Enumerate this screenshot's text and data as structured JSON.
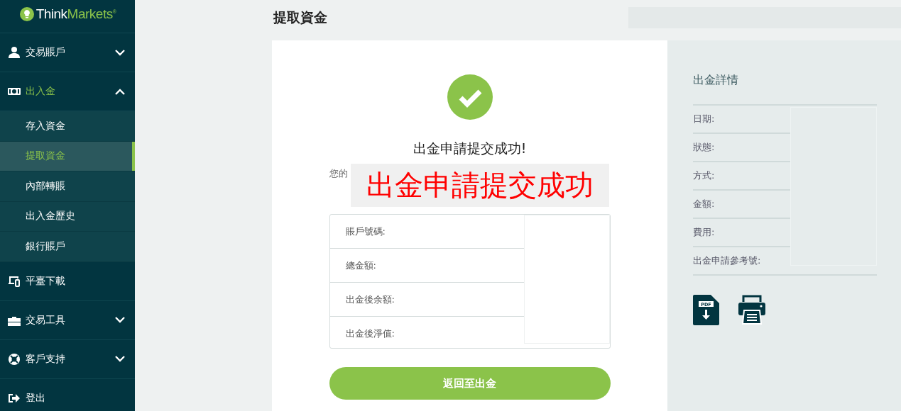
{
  "logo": {
    "think": "Think",
    "markets": "Markets",
    "reg": "®"
  },
  "sidebar": {
    "items": [
      {
        "label": "交易賬戶",
        "expanded": false
      },
      {
        "label": "出入金",
        "expanded": true,
        "children": [
          {
            "label": "存入資金",
            "selected": false
          },
          {
            "label": "提取資金",
            "selected": true
          },
          {
            "label": "內部轉賬",
            "selected": false
          },
          {
            "label": "出入金歷史",
            "selected": false
          },
          {
            "label": "銀行賬戶",
            "selected": false
          }
        ]
      },
      {
        "label": "平臺下載"
      },
      {
        "label": "交易工具",
        "expanded": false
      },
      {
        "label": "客戶支持",
        "expanded": false
      },
      {
        "label": "登出"
      }
    ]
  },
  "page_title": "提取資金",
  "result": {
    "title": "出金申請提交成功!",
    "notice_fragments": [
      "您的"
    ],
    "overlay_label": "出金申請提交成功",
    "summary_rows": [
      {
        "label": "賬戶號碼:"
      },
      {
        "label": "總金額:"
      },
      {
        "label": "出金後余額:"
      },
      {
        "label": "出金後淨值:"
      }
    ],
    "button": "返回至出金"
  },
  "details": {
    "title": "出金詳情",
    "rows": [
      {
        "label": "日期:"
      },
      {
        "label": "狀態:"
      },
      {
        "label": "方式:"
      },
      {
        "label": "金額:"
      },
      {
        "label": "費用:"
      },
      {
        "label": "出金申請參考號:"
      }
    ],
    "pdf_label": "PDF"
  }
}
